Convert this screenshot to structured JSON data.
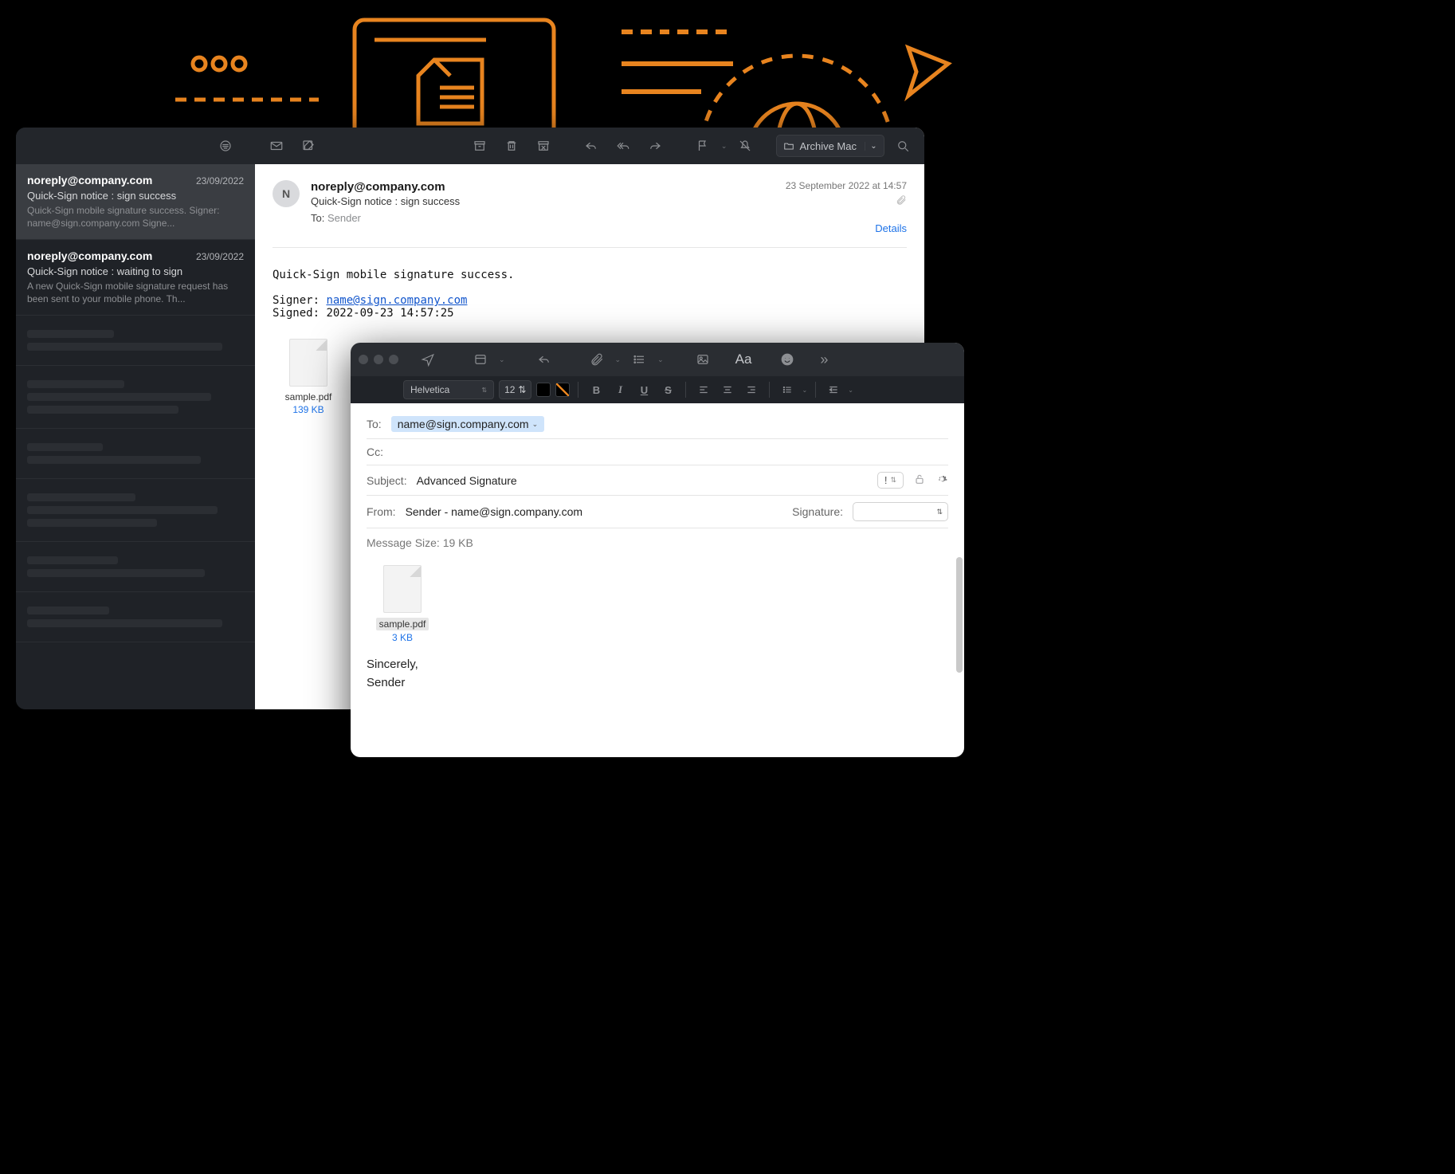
{
  "decor": {},
  "sidebar": {
    "messages": [
      {
        "sender": "noreply@company.com",
        "date": "23/09/2022",
        "subject": "Quick-Sign notice : sign success",
        "preview": "Quick-Sign mobile signature success. Signer: name@sign.company.com Signe...",
        "selected": true
      },
      {
        "sender": "noreply@company.com",
        "date": "23/09/2022",
        "subject": "Quick-Sign notice : waiting to sign",
        "preview": "A new Quick-Sign mobile signature request has been sent to your mobile phone. Th...",
        "selected": false
      }
    ]
  },
  "toolbar": {
    "folder_label": "Archive Mac"
  },
  "reader": {
    "avatar_initial": "N",
    "from": "noreply@company.com",
    "subject": "Quick-Sign notice : sign success",
    "to_label": "To:",
    "to_value": "Sender",
    "meta_date": "23 September 2022 at 14:57",
    "details_label": "Details",
    "body_line1": "Quick-Sign mobile signature success.",
    "body_signer_label": "Signer:",
    "body_signer_email": "name@sign.company.com",
    "body_signed_label": "Signed:",
    "body_signed_value": "2022-09-23 14:57:25",
    "attachment": {
      "name": "sample.pdf",
      "size": "139 KB"
    }
  },
  "compose": {
    "font_name": "Helvetica",
    "font_size": "12",
    "to_label": "To:",
    "to_chip": "name@sign.company.com",
    "cc_label": "Cc:",
    "subject_label": "Subject:",
    "subject_value": "Advanced Signature",
    "priority_label": "!",
    "from_label": "From:",
    "from_value": "Sender - name@sign.company.com",
    "signature_label": "Signature:",
    "msg_size_label": "Message Size:",
    "msg_size_value": "19 KB",
    "attachment": {
      "name": "sample.pdf",
      "size": "3 KB"
    },
    "sig_line1": "Sincerely,",
    "sig_line2": "Sender"
  }
}
